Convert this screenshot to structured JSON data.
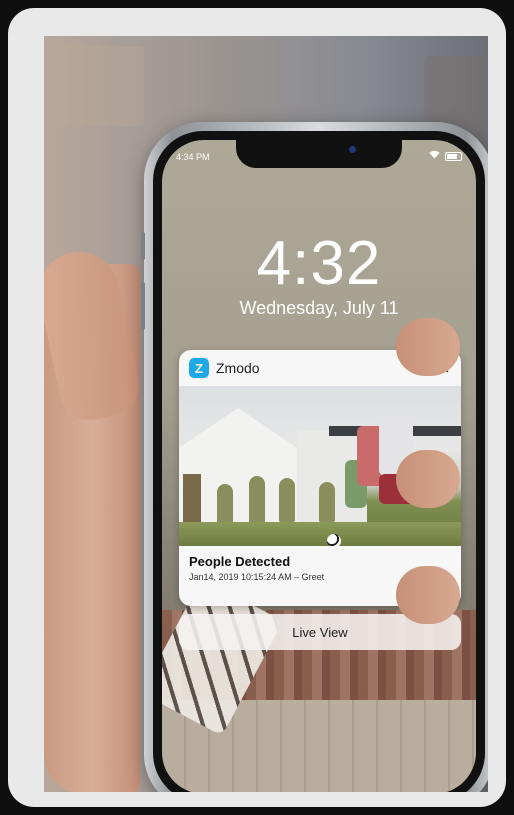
{
  "status_bar": {
    "time": "4:34 PM"
  },
  "lock_screen": {
    "time": "4:32",
    "date": "Wednesday, July 11"
  },
  "notification": {
    "app_icon_letter": "Z",
    "app_name": "Zmodo",
    "close_glyph": "✕",
    "title": "People Detected",
    "subtitle": "Jan14, 2019 10:15:24 AM – Greet"
  },
  "actions": {
    "live_view_label": "Live View"
  },
  "colors": {
    "app_icon": "#1ea8e8",
    "accent_notch_dot": "#1f3a7a"
  },
  "icons": [
    "wifi-icon",
    "battery-icon",
    "close-icon",
    "zmodo-app-icon"
  ]
}
